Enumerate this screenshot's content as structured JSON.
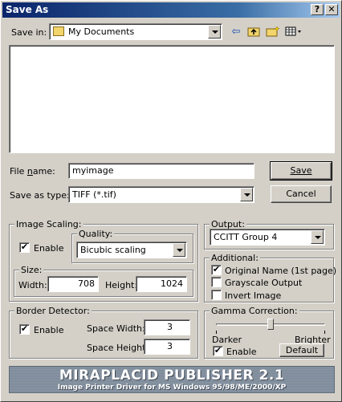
{
  "window": {
    "title": "Save As"
  },
  "title_buttons": {
    "help": "?",
    "close": "✕"
  },
  "save_in": {
    "label": "Save in:",
    "value": "My Documents",
    "icons": [
      "back-arrow-icon",
      "up-folder-icon",
      "new-folder-icon",
      "view-menu-icon"
    ]
  },
  "file_list": {
    "items": []
  },
  "file_name": {
    "label": "File name:",
    "value": "myimage"
  },
  "save_as_type": {
    "label": "Save as type:",
    "value": "TIFF (*.tif)"
  },
  "buttons": {
    "save": "Save",
    "cancel": "Cancel",
    "default": "Default"
  },
  "image_scaling": {
    "title": "Image Scaling:",
    "enable_label": "Enable",
    "enable_checked": true,
    "quality_title": "Quality:",
    "quality_value": "Bicubic scaling",
    "size_title": "Size:",
    "width_label": "Width:",
    "width_value": "708",
    "height_label": "Height:",
    "height_value": "1024"
  },
  "output": {
    "title": "Output:",
    "value": "CCITT Group 4"
  },
  "additional": {
    "title": "Additional:",
    "original_name_label": "Original Name (1st page)",
    "original_name_checked": true,
    "grayscale_label": "Grayscale Output",
    "grayscale_checked": false,
    "invert_label": "Invert Image",
    "invert_checked": false
  },
  "border_detector": {
    "title": "Border Detector:",
    "enable_label": "Enable",
    "enable_checked": true,
    "space_width_label": "Space Width:",
    "space_width_value": "3",
    "space_height_label": "Space Height:",
    "space_height_value": "3"
  },
  "gamma": {
    "title": "Gamma Correction:",
    "darker_label": "Darker",
    "brighter_label": "Brighter",
    "enable_label": "Enable",
    "enable_checked": true,
    "slider_level": 0.5
  },
  "banner": {
    "title": "MIRAPLACID PUBLISHER 2.1",
    "subtitle": "Image Printer Driver for MS Windows 95/98/ME/2000/XP"
  },
  "colors": {
    "titlebar": "#0a246a",
    "face": "#d4d0c8"
  }
}
